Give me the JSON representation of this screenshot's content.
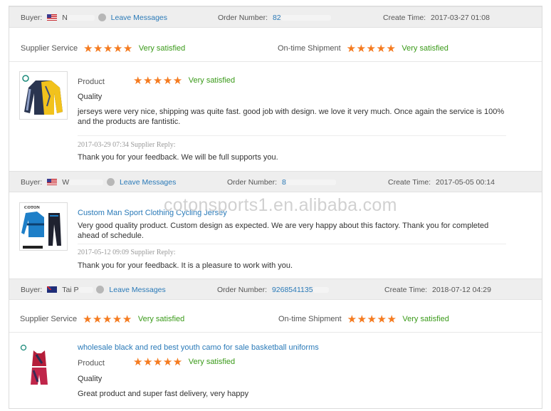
{
  "reviews": [
    {
      "buyer_label": "Buyer:",
      "buyer_name": "N",
      "leave_messages": "Leave Messages",
      "order_label": "Order Number:",
      "order_number": "82",
      "create_label": "Create Time:",
      "create_time": "2017-03-27 01:08",
      "supplier_service_label": "Supplier Service",
      "supplier_service_rating": 5,
      "supplier_service_text": "Very satisfied",
      "shipment_label": "On-time Shipment",
      "shipment_rating": 5,
      "shipment_text": "Very satisfied",
      "product_label": "Product",
      "product_rating": 5,
      "product_text": "Very satisfied",
      "quality_label": "Quality",
      "comment": "jerseys were very nice, shipping was quite fast. good job with design. we love it very much. Once again the service is 100% and the products are fantistic.",
      "reply_meta": "2017-03-29 07:34  Supplier Reply:",
      "reply": "Thank you for your feedback. We will be full supports you."
    },
    {
      "buyer_label": "Buyer:",
      "buyer_name": "W",
      "leave_messages": "Leave Messages",
      "order_label": "Order Number:",
      "order_number": "8",
      "create_label": "Create Time:",
      "create_time": "2017-05-05 00:14",
      "product_title": "Custom Man Sport Clothing Cycling Jersey",
      "comment": "Very good quality product. Custom design as expected. We are very happy about this factory. Thank you for completed ahead of schedule.",
      "reply_meta": "2017-05-12 09:09  Supplier Reply:",
      "reply": "Thank you for your feedback. It is a pleasure to work with you.",
      "thumb_brand": "COTON"
    },
    {
      "buyer_label": "Buyer:",
      "buyer_name": "Tai P",
      "leave_messages": "Leave Messages",
      "order_label": "Order Number:",
      "order_number": "9268541135",
      "create_label": "Create Time:",
      "create_time": "2018-07-12 04:29",
      "supplier_service_label": "Supplier Service",
      "supplier_service_rating": 5,
      "supplier_service_text": "Very satisfied",
      "shipment_label": "On-time Shipment",
      "shipment_rating": 5,
      "shipment_text": "Very satisfied",
      "product_title": "wholesale black and red best youth camo for sale basketball uniforms",
      "product_label": "Product",
      "product_rating": 5,
      "product_text": "Very satisfied",
      "quality_label": "Quality",
      "comment": "Great product and super fast delivery, very happy"
    }
  ],
  "watermark": "cotonsports1.en.alibaba.com",
  "colors": {
    "star": "#f57b20",
    "satisfied": "#3a9a19",
    "link": "#2a7ab8",
    "bar": "#eeeeee"
  },
  "icons": {
    "star": "star-icon",
    "message": "message-icon",
    "flag_us": "us-flag-icon",
    "flag_au": "au-flag-icon"
  }
}
